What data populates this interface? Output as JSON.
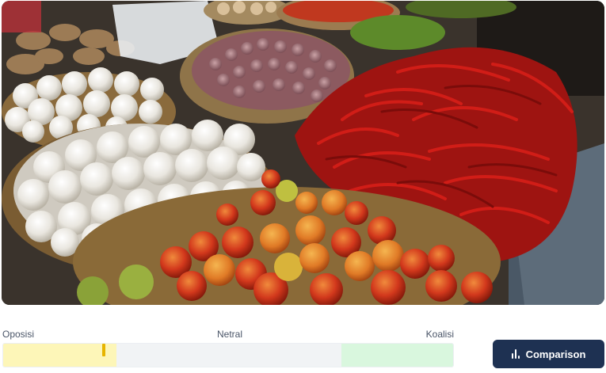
{
  "image": {
    "alt": "Market produce: garlic, shallots, red chilies, green chilies, potatoes and tomatoes"
  },
  "scale": {
    "left_label": "Oposisi",
    "middle_label": "Netral",
    "right_label": "Koalisi",
    "marker_position": 0.22
  },
  "comparison_button": {
    "label": "Comparison",
    "icon": "bar-chart-icon"
  },
  "colors": {
    "opposition": "#fdf6b8",
    "neutral": "#f1f3f5",
    "coalition": "#d9f7de",
    "marker": "#e6b400",
    "button": "#1e3152"
  }
}
